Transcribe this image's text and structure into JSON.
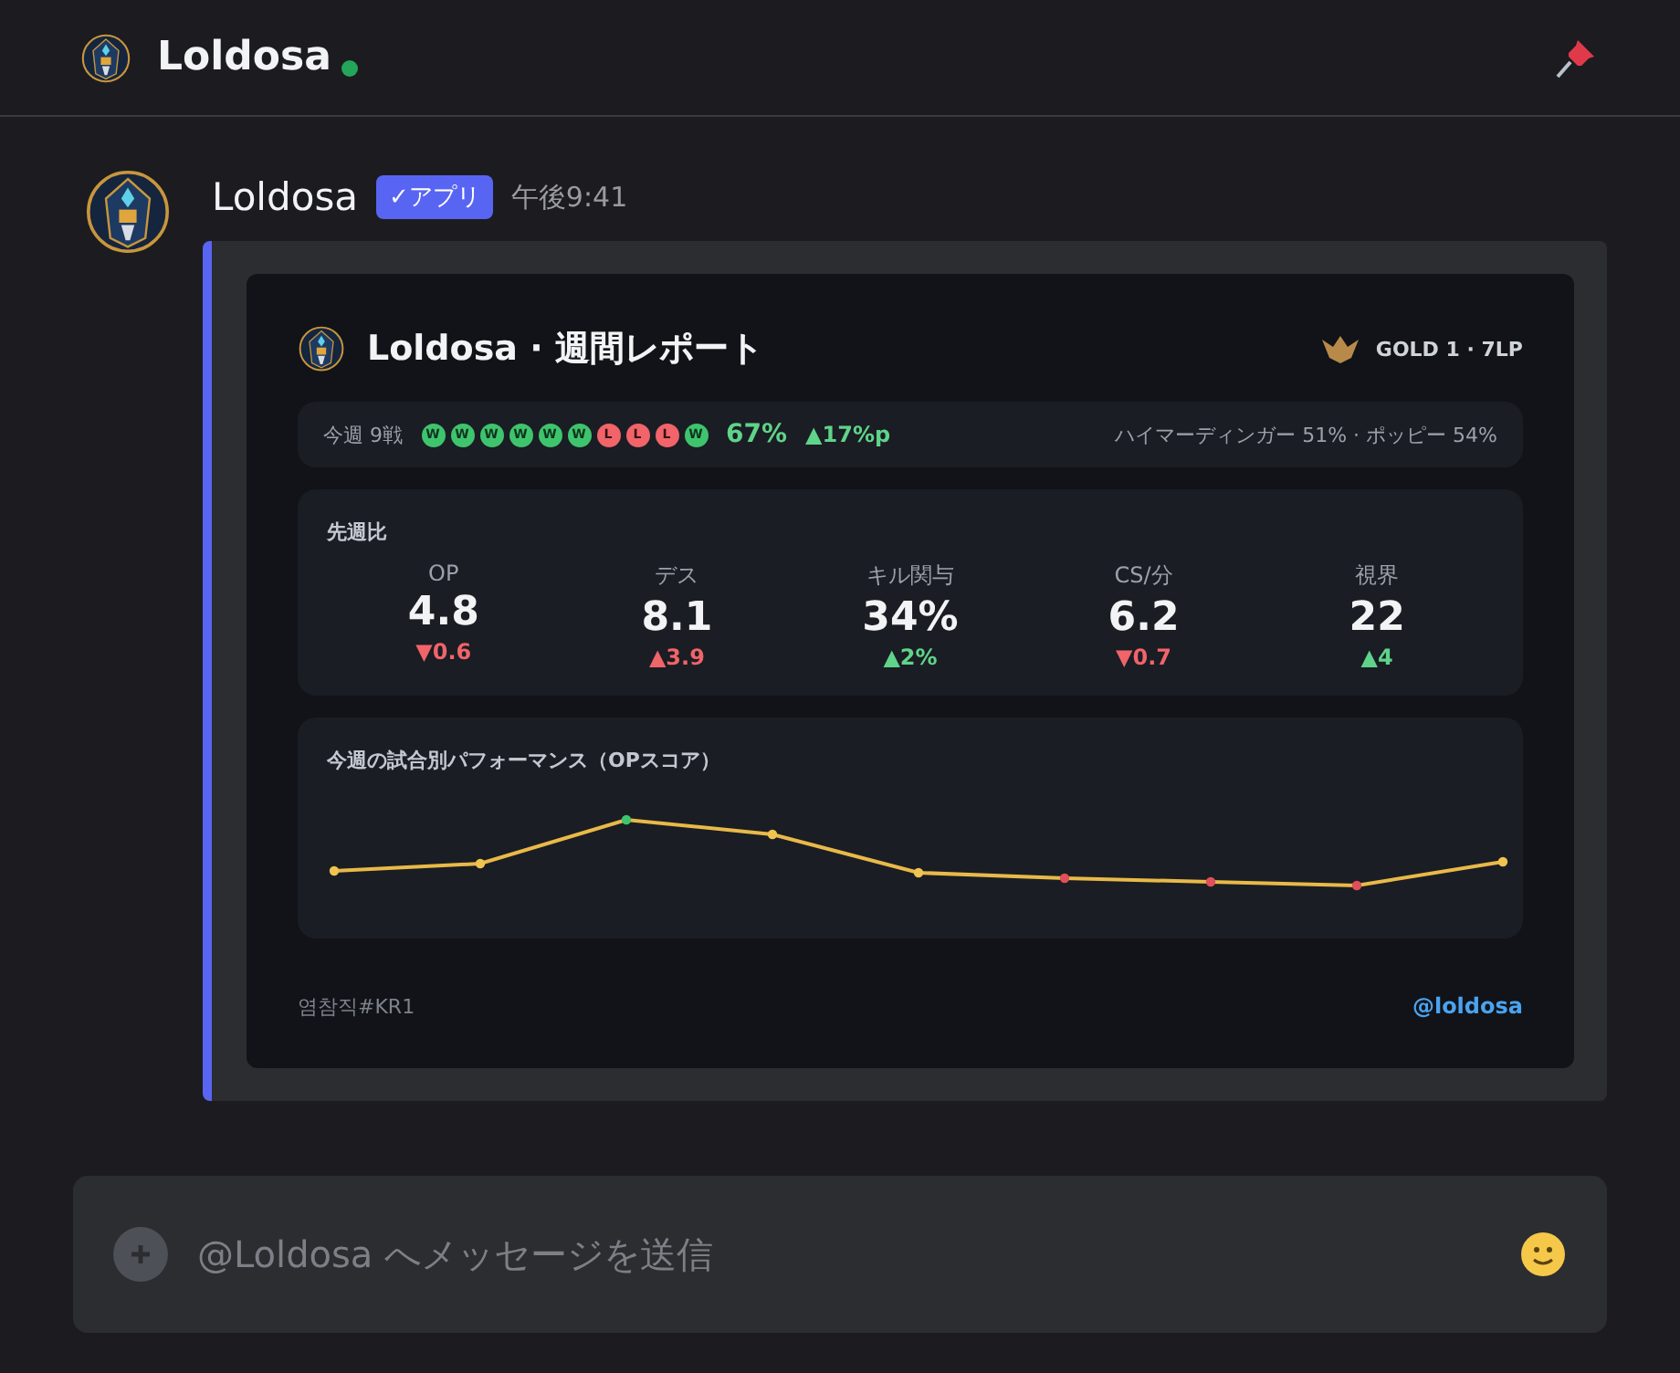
{
  "header": {
    "title": "Loldosa",
    "online": true
  },
  "message": {
    "author": "Loldosa",
    "badge": "✓アプリ",
    "time": "午後9:41",
    "report": {
      "title": "Loldosa · 週間レポート",
      "rank": "GOLD 1 · 7LP",
      "summary": {
        "label": "今週 9戦",
        "results": [
          {
            "label": "W",
            "kind": "win"
          },
          {
            "label": "W",
            "kind": "win"
          },
          {
            "label": "W",
            "kind": "win"
          },
          {
            "label": "W",
            "kind": "win"
          },
          {
            "label": "W",
            "kind": "win"
          },
          {
            "label": "W",
            "kind": "win"
          },
          {
            "label": "L",
            "kind": "loss"
          },
          {
            "label": "L",
            "kind": "loss"
          },
          {
            "label": "L",
            "kind": "loss"
          },
          {
            "label": "W",
            "kind": "win"
          }
        ],
        "winrate": "67%",
        "change": "▲17%p",
        "champions": "ハイマーディンガー 51% · ポッピー 54%"
      },
      "comparison": {
        "title": "先週比",
        "stats": [
          {
            "label": "OP",
            "value": "4.8",
            "delta": "▼0.6",
            "kind": "bad"
          },
          {
            "label": "デス",
            "value": "8.1",
            "delta": "▲3.9",
            "kind": "bad"
          },
          {
            "label": "キル関与",
            "value": "34%",
            "delta": "▲2%",
            "kind": "good"
          },
          {
            "label": "CS/分",
            "value": "6.2",
            "delta": "▼0.7",
            "kind": "bad"
          },
          {
            "label": "視界",
            "value": "22",
            "delta": "▲4",
            "kind": "good"
          }
        ]
      },
      "performance": {
        "title": "今週の試合別パフォーマンス（OPスコア）"
      },
      "footer": {
        "riot_id": "염참직#KR1",
        "handle": "@loldosa"
      }
    }
  },
  "composer": {
    "placeholder": "@Loldosa へメッセージを送信"
  }
}
